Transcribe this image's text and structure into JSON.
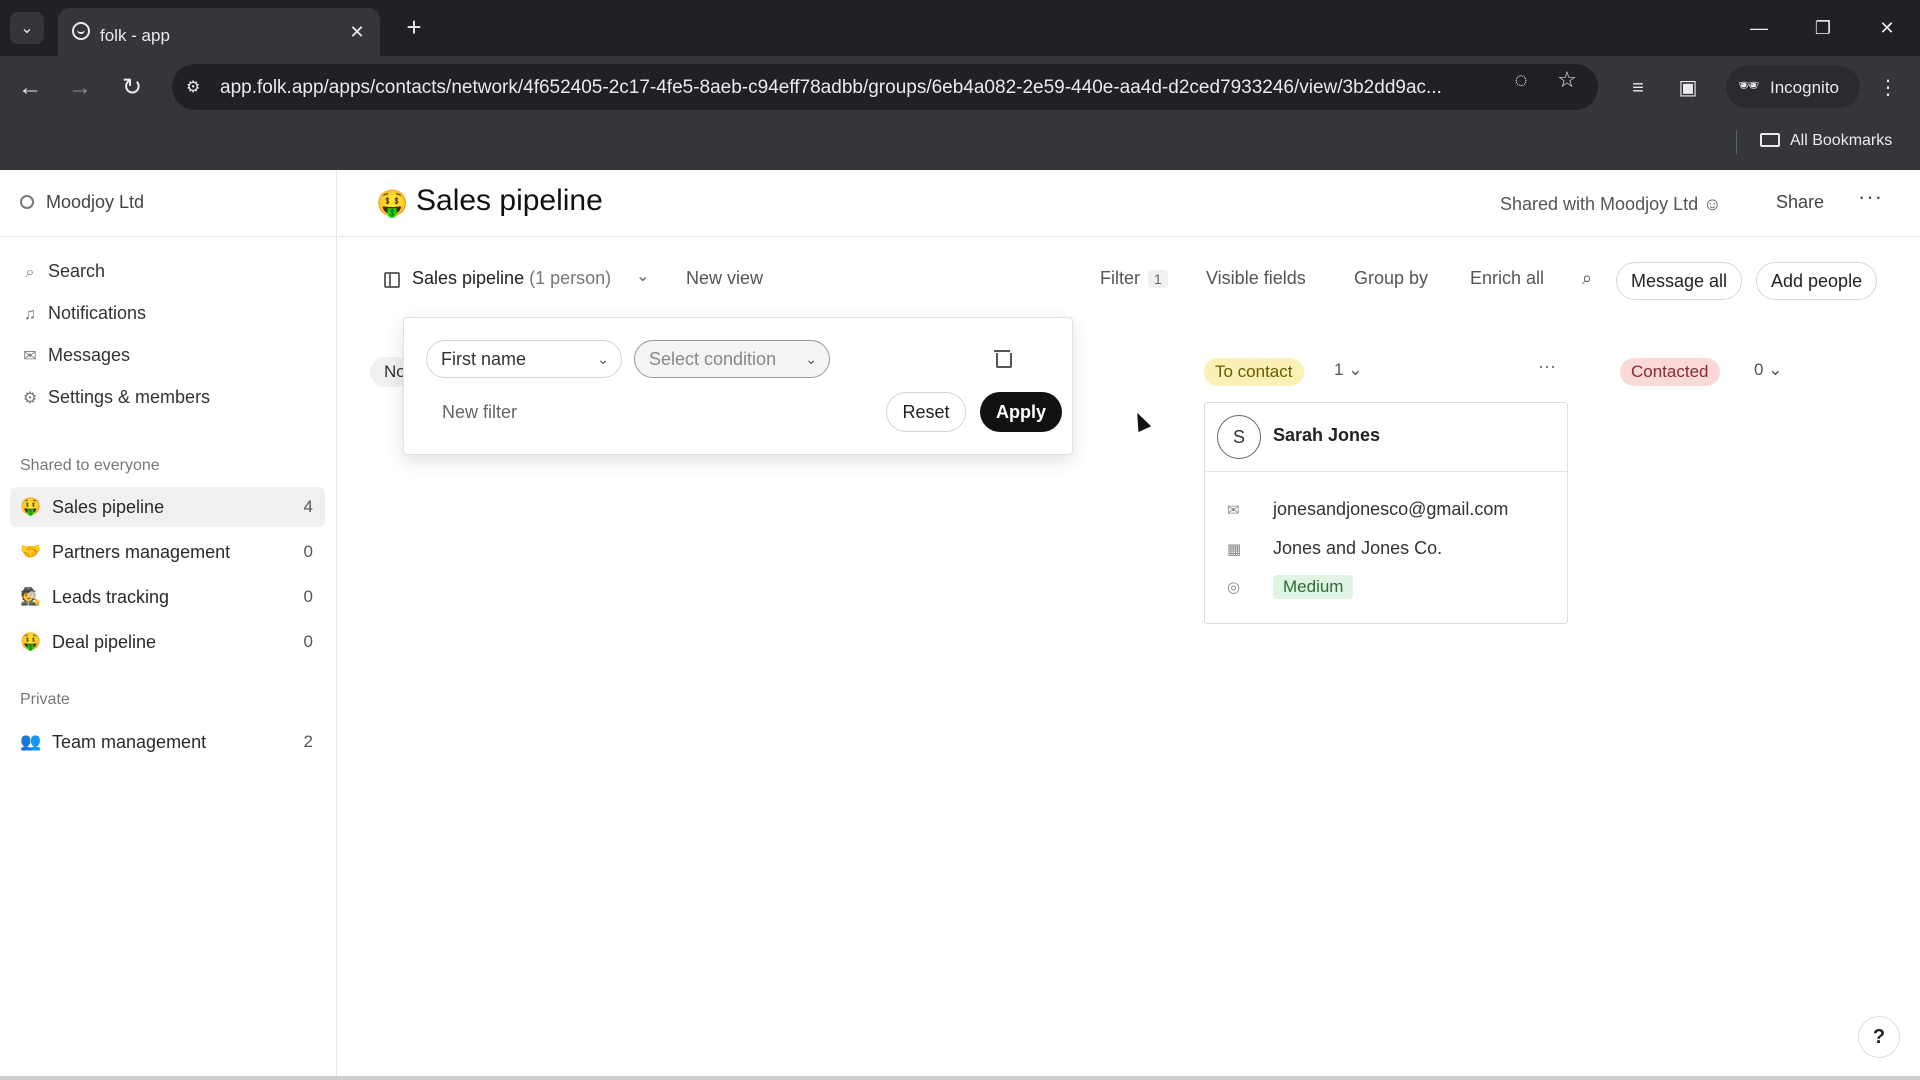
{
  "browser": {
    "tab_title": "folk - app",
    "url": "app.folk.app/apps/contacts/network/4f652405-2c17-4fe5-8aeb-c94eff78adbb/groups/6eb4a082-2e59-440e-aa4d-d2ced7933246/view/3b2dd9ac...",
    "incognito_label": "Incognito",
    "all_bookmarks": "All Bookmarks"
  },
  "sidebar": {
    "workspace": "Moodjoy Ltd",
    "nav": [
      {
        "label": "Search",
        "icon": "search-icon"
      },
      {
        "label": "Notifications",
        "icon": "bell-icon"
      },
      {
        "label": "Messages",
        "icon": "mail-icon"
      },
      {
        "label": "Settings & members",
        "icon": "gear-icon"
      }
    ],
    "shared_heading": "Shared to everyone",
    "shared_groups": [
      {
        "emoji": "🤑",
        "label": "Sales pipeline",
        "count": "4"
      },
      {
        "emoji": "🤝",
        "label": "Partners management",
        "count": "0"
      },
      {
        "emoji": "🕵",
        "label": "Leads tracking",
        "count": "0"
      },
      {
        "emoji": "🤑",
        "label": "Deal pipeline",
        "count": "0"
      }
    ],
    "private_heading": "Private",
    "private_groups": [
      {
        "emoji": "👥",
        "label": "Team management",
        "count": "2"
      }
    ]
  },
  "header": {
    "emoji": "🤑",
    "title": "Sales pipeline",
    "shared_with": "Shared with Moodjoy Ltd",
    "share": "Share",
    "more": "···"
  },
  "viewbar": {
    "view_name": "Sales pipeline",
    "view_count": "(1 person)",
    "new_view": "New view",
    "filter": "Filter",
    "filter_count": "1",
    "visible_fields": "Visible fields",
    "group_by": "Group by",
    "enrich_all": "Enrich all",
    "message_all": "Message all",
    "add_people": "Add people"
  },
  "filter_popover": {
    "field": "First name",
    "condition_placeholder": "Select condition",
    "new_filter": "New filter",
    "reset": "Reset",
    "apply": "Apply",
    "hidden_column_chip": "No"
  },
  "board": {
    "columns": [
      {
        "label": "To contact",
        "count": "1",
        "color": "#fbf0b5"
      },
      {
        "label": "Contacted",
        "count": "0",
        "color": "#fbd9d9"
      }
    ],
    "card": {
      "initial": "S",
      "name": "Sarah Jones",
      "email": "jonesandjonesco@gmail.com",
      "company": "Jones and Jones Co.",
      "priority": "Medium"
    }
  },
  "help": "?"
}
